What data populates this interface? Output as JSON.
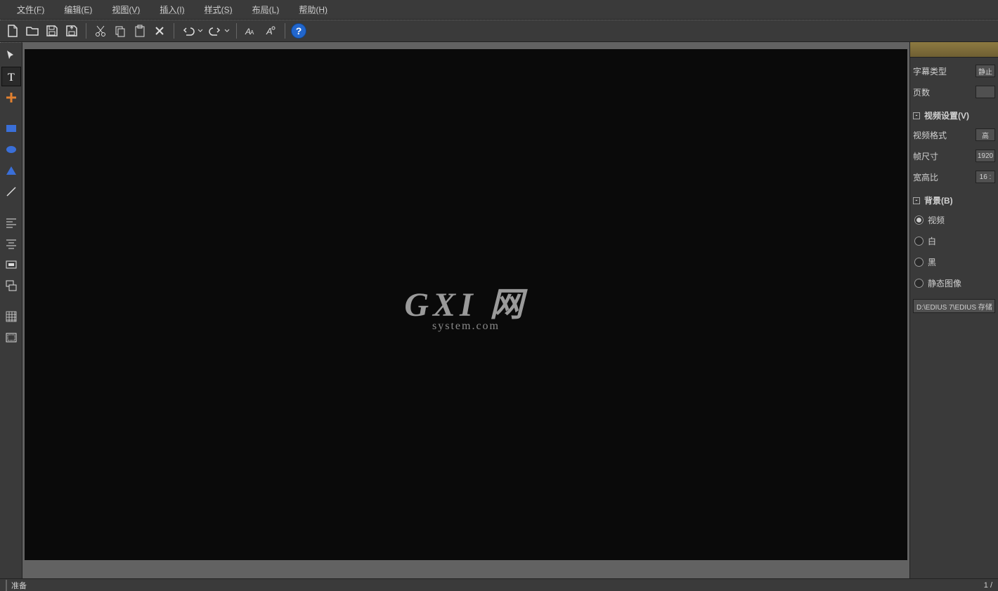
{
  "menu": {
    "file": "文件(F)",
    "edit": "编辑(E)",
    "view": "视图(V)",
    "insert": "插入(I)",
    "style": "样式(S)",
    "layout": "布局(L)",
    "help": "帮助(H)"
  },
  "watermark": {
    "main": "GXI 网",
    "sub": "system.com"
  },
  "panel": {
    "title_type_label": "字幕类型",
    "title_type_value": "静止",
    "pages_label": "页数",
    "pages_value": "",
    "video_section": "视频设置(V)",
    "video_format_label": "视频格式",
    "video_format_value": "高",
    "frame_size_label": "帧尺寸",
    "frame_size_value": "1920",
    "aspect_label": "宽高比",
    "aspect_value": "16 :",
    "background_section": "背景(B)",
    "bg_video": "视频",
    "bg_white": "白",
    "bg_black": "黑",
    "bg_still": "静态图像",
    "path": "D:\\EDIUS 7\\EDIUS 存储"
  },
  "status": {
    "ready": "准备",
    "page": "1 /"
  },
  "help_glyph": "?"
}
